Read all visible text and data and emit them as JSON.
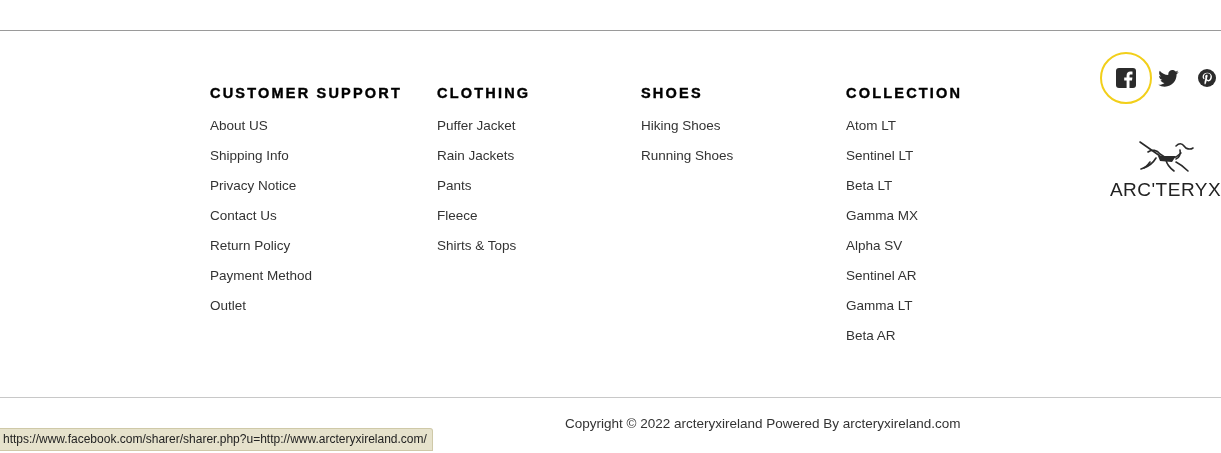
{
  "columns": [
    {
      "heading": "CUSTOMER SUPPORT",
      "links": [
        "About US",
        "Shipping Info",
        "Privacy Notice",
        "Contact Us",
        "Return Policy",
        "Payment Method",
        "Outlet"
      ]
    },
    {
      "heading": "CLOTHING",
      "links": [
        "Puffer Jacket",
        "Rain Jackets",
        "Pants",
        "Fleece",
        "Shirts & Tops"
      ]
    },
    {
      "heading": "SHOES",
      "links": [
        "Hiking Shoes",
        "Running Shoes"
      ]
    },
    {
      "heading": "COLLECTION",
      "links": [
        "Atom LT",
        "Sentinel LT",
        "Beta LT",
        "Gamma MX",
        "Alpha SV",
        "Sentinel AR",
        "Gamma LT",
        "Beta AR"
      ]
    }
  ],
  "social": [
    {
      "kind": "facebook",
      "highlighted": true
    },
    {
      "kind": "twitter",
      "highlighted": false
    },
    {
      "kind": "pinterest",
      "highlighted": false
    }
  ],
  "logo": {
    "text": "ARC'TERYX"
  },
  "copyright": "Copyright © 2022 arcteryxireland Powered By arcteryxireland.com",
  "status_bar": {
    "url": "https://www.facebook.com/sharer/sharer.php?u=http://www.arcteryxireland.com/"
  }
}
